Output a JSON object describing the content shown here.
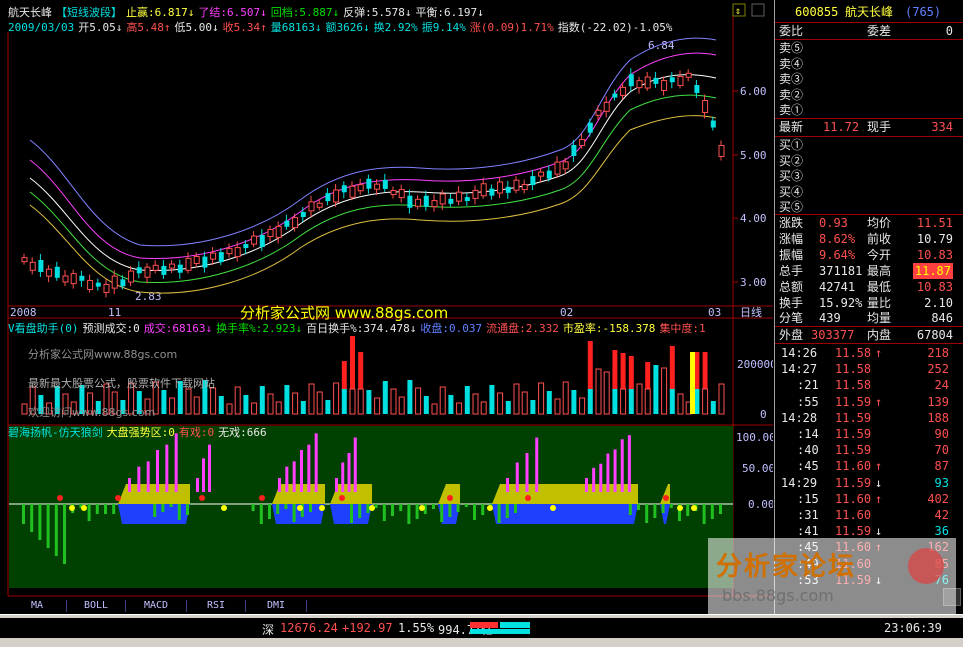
{
  "main_chart": {
    "header1": [
      "航天长峰",
      "【短线波段】",
      "止赢:6.817↓",
      "了结:6.507↓",
      "回档:5.887↓",
      "反弹:5.578↓",
      "平衡:6.197↓"
    ],
    "header2": [
      "2009/03/03",
      "开5.05↓",
      "高5.48↑",
      "低5.00↓",
      "收5.34↑",
      "量68163↓",
      "额3626↓",
      "换2.92%",
      "振9.14%",
      "涨(0.09)1.71%",
      "指数(-22.02)-1.05%"
    ],
    "y_labels": [
      "6.00",
      "5.00",
      "4.00",
      "3.00"
    ],
    "high_label": "6.84",
    "low_label": "2.83",
    "x_labels": [
      "2008",
      "11",
      "02",
      "03"
    ],
    "axis_label": "日线",
    "watermark": "分析家公式网 www.88gs.com"
  },
  "indicator1": {
    "header": [
      "V看盘助手(0)",
      "预测成交:0",
      "成交:68163↓",
      "换手率%:2.923↓",
      "百日换手%:374.478↓",
      "收盘:0.037",
      "流通盘:2.332",
      "市盈率:-158.378",
      "集中度:1"
    ],
    "y_labels": [
      "200000",
      "0"
    ],
    "text1": "分析家公式网www.88gs.com",
    "text2": "最新最大股票公式，股票软件下载网站",
    "text3": "欢迎访问www.88gs.com"
  },
  "indicator2": {
    "header": [
      "碧海扬帆-仿天狼剑",
      "大盘强势区:0",
      "有戏:0",
      "无戏:666"
    ],
    "y_labels": [
      "100.00",
      "50.00",
      "0.00"
    ]
  },
  "tabs": [
    "MA",
    "BOLL",
    "MACD",
    "RSI",
    "DMI"
  ],
  "status_bar": {
    "market": "深",
    "index": "12676.24",
    "change": "+192.97",
    "pct": "1.55%",
    "amount": "994.71亿",
    "time": "23:06:39"
  },
  "quote": {
    "code": "600855",
    "name": "航天长峰",
    "code_num": "(765)",
    "weibi_label": "委比",
    "weicha_label": "委差",
    "weicha_value": "0",
    "sells": [
      "卖⑤",
      "卖④",
      "卖③",
      "卖②",
      "卖①"
    ],
    "buys": [
      "买①",
      "买②",
      "买③",
      "买④",
      "买⑤"
    ],
    "latest_label": "最新",
    "latest": "11.72",
    "current_hand_label": "现手",
    "current_hand": "334",
    "stats": [
      {
        "l1": "涨跌",
        "v1": "0.93",
        "l2": "均价",
        "v2": "11.51"
      },
      {
        "l1": "涨幅",
        "v1": "8.62%",
        "l2": "前收",
        "v2": "10.79"
      },
      {
        "l1": "振幅",
        "v1": "9.64%",
        "l2": "今开",
        "v2": "10.83"
      },
      {
        "l1": "总手",
        "v1": "371181",
        "l2": "最高",
        "v2": "11.87"
      },
      {
        "l1": "总额",
        "v1": "42741",
        "l2": "最低",
        "v2": "10.83"
      },
      {
        "l1": "换手",
        "v1": "15.92%",
        "l2": "量比",
        "v2": "2.10"
      },
      {
        "l1": "分笔",
        "v1": "439",
        "l2": "均量",
        "v2": "846"
      }
    ],
    "outer_label": "外盘",
    "outer": "303377",
    "inner_label": "内盘",
    "inner": "67804"
  },
  "ticks": [
    {
      "t": "14:26",
      "p": "11.58",
      "a": "↑",
      "v": "218"
    },
    {
      "t": "14:27",
      "p": "11.58",
      "a": "",
      "v": "252"
    },
    {
      "t": ":21",
      "p": "11.58",
      "a": "",
      "v": "24"
    },
    {
      "t": ":55",
      "p": "11.59",
      "a": "↑",
      "v": "139"
    },
    {
      "t": "14:28",
      "p": "11.59",
      "a": "",
      "v": "188"
    },
    {
      "t": ":14",
      "p": "11.59",
      "a": "",
      "v": "90"
    },
    {
      "t": ":40",
      "p": "11.59",
      "a": "",
      "v": "70"
    },
    {
      "t": ":45",
      "p": "11.60",
      "a": "↑",
      "v": "87"
    },
    {
      "t": "14:29",
      "p": "11.59",
      "a": "↓",
      "v": "93"
    },
    {
      "t": ":15",
      "p": "11.60",
      "a": "↑",
      "v": "402"
    },
    {
      "t": ":31",
      "p": "11.60",
      "a": "",
      "v": "42"
    },
    {
      "t": ":41",
      "p": "11.59",
      "a": "↓",
      "v": "36"
    },
    {
      "t": ":45",
      "p": "11.60",
      "a": "↑",
      "v": "162"
    },
    {
      "t": ":49",
      "p": "11.60",
      "a": "",
      "v": "85"
    },
    {
      "t": ":53",
      "p": "11.59",
      "a": "↓",
      "v": "76"
    }
  ],
  "forum_watermark": "分析家论坛",
  "forum_url": "bbs.88gs.com"
}
